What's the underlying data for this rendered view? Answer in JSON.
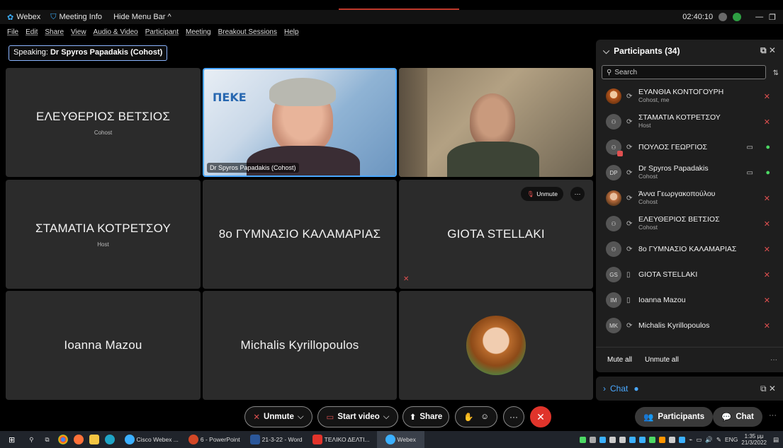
{
  "titlebar": {
    "app": "Webex",
    "meeting_info": "Meeting Info",
    "hide_menu": "Hide Menu Bar ^",
    "time": "02:40:10",
    "min": "—",
    "restore": "❐"
  },
  "menu": [
    "File",
    "Edit",
    "Share",
    "View",
    "Audio & Video",
    "Participant",
    "Meeting",
    "Breakout Sessions",
    "Help"
  ],
  "speaking": {
    "prefix": "Speaking: ",
    "name": "Dr Spyros Papadakis (Cohost)"
  },
  "tiles": {
    "t1": {
      "name": "ΕΛΕΥΘΕΡΙΟΣ ΒΕΤΣΙΟΣ",
      "role": "Cohost"
    },
    "t2": {
      "chip": "Dr Spyros Papadakis (Cohost)",
      "logo": "ΠΕΚΕ"
    },
    "t4": {
      "name": "ΣΤΑΜΑΤΙΑ ΚΟΤΡΕΤΣΟΥ",
      "role": "Host"
    },
    "t5": {
      "name": "8ο ΓΥΜΝΑΣΙΟ ΚΑΛΑΜΑΡΙΑΣ"
    },
    "t6": {
      "name": "GIOTA STELLAKI",
      "unmute": "Unmute",
      "more": "···"
    },
    "t7": {
      "name": "Ioanna Mazou"
    },
    "t8": {
      "name": "Michalis Kyrillopoulos"
    }
  },
  "participants": {
    "title": "Participants (34)",
    "search_placeholder": "Search",
    "list": [
      {
        "initials": "",
        "name": "ΕΥΑΝΘΙΑ ΚΟΝΤΟΓΟΥΡΗ",
        "role": "Cohost, me"
      },
      {
        "initials": "",
        "name": "ΣΤΑΜΑΤΙΑ ΚΟΤΡΕΤΣΟΥ",
        "role": "Host"
      },
      {
        "initials": "",
        "name": "ΠΟΥΛΟΣ ΓΕΩΡΓΙΟΣ",
        "role": ""
      },
      {
        "initials": "DP",
        "name": "Dr Spyros Papadakis",
        "role": "Cohost"
      },
      {
        "initials": "",
        "name": "Άννα Γεωργακοπούλου",
        "role": "Cohost"
      },
      {
        "initials": "",
        "name": "ΕΛΕΥΘΕΡΙΟΣ ΒΕΤΣΙΟΣ",
        "role": "Cohost"
      },
      {
        "initials": "",
        "name": "8ο ΓΥΜΝΑΣΙΟ ΚΑΛΑΜΑΡΙΑΣ",
        "role": ""
      },
      {
        "initials": "GS",
        "name": "GIOTA STELLAKI",
        "role": ""
      },
      {
        "initials": "IM",
        "name": "Ioanna Mazou",
        "role": ""
      },
      {
        "initials": "MK",
        "name": "Michalis Kyrillopoulos",
        "role": ""
      }
    ],
    "mute_all": "Mute all",
    "unmute_all": "Unmute all"
  },
  "chat": {
    "label": "Chat"
  },
  "controls": {
    "unmute": "Unmute",
    "start_video": "Start video",
    "share": "Share",
    "participants": "Participants",
    "chat": "Chat",
    "more": "···"
  },
  "taskbar": {
    "apps": [
      "Cisco Webex ...",
      "6 - PowerPoint",
      "21-3-22 - Word",
      "ΤΕΛΙΚΟ ΔΕΛΤΙ...",
      "Webex"
    ],
    "lang": "ENG",
    "time": "1:35 μμ",
    "date": "21/3/2022"
  }
}
